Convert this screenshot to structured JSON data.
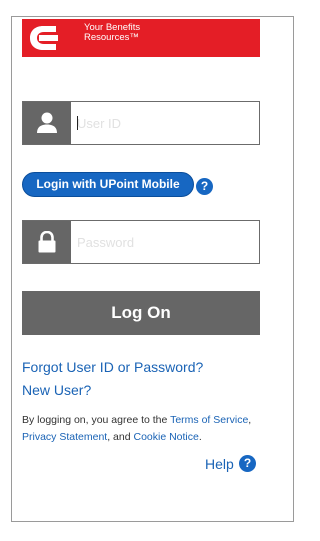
{
  "banner": {
    "line1": "Your Benefits",
    "line2": "Resources™",
    "brand_color": "#e41e26",
    "logo_icon": "cummins-logo-icon"
  },
  "userid": {
    "placeholder": "User ID",
    "value": "",
    "icon": "user-icon"
  },
  "upoint": {
    "label": "Login with UPoint Mobile",
    "help_glyph": "?"
  },
  "password": {
    "placeholder": "Password",
    "value": "",
    "icon": "lock-icon"
  },
  "logon": {
    "label": "Log On"
  },
  "links": {
    "forgot": "Forgot User ID or Password?",
    "new_user": "New User?"
  },
  "terms": {
    "prefix": "By logging on, you agree to the ",
    "terms_link": "Terms of Service",
    "sep1": ", ",
    "privacy_link": "Privacy Statement",
    "sep2": ", and ",
    "cookie_link": "Cookie Notice",
    "suffix": "."
  },
  "help": {
    "label": "Help",
    "glyph": "?"
  },
  "colors": {
    "accent": "#1767c2",
    "link": "#1a63b5",
    "button_gray": "#666666"
  }
}
